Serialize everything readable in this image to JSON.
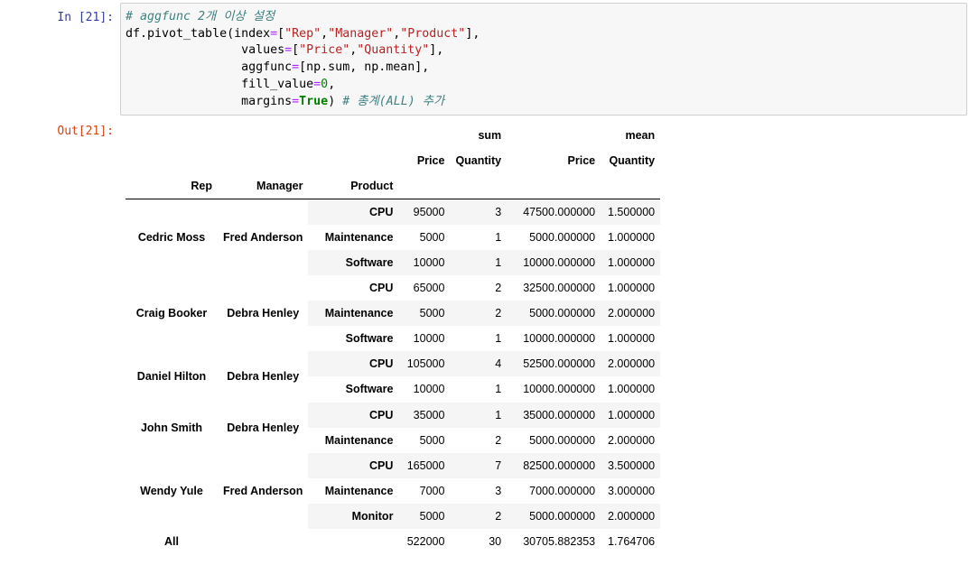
{
  "input_prompt": "In [21]:",
  "output_prompt": "Out[21]:",
  "code": {
    "comment1": "# aggfunc 2개 이상 설정",
    "l1_a": "df.pivot_table(index",
    "l1_b": "=",
    "l1_c": "[",
    "l1_s1": "\"Rep\"",
    "l1_s2": "\"Manager\"",
    "l1_s3": "\"Product\"",
    "l1_d": "],",
    "l2_a": "values",
    "l2_b": "=",
    "l2_c": "[",
    "l2_s1": "\"Price\"",
    "l2_s2": "\"Quantity\"",
    "l2_d": "],",
    "l3_a": "aggfunc",
    "l3_b": "=",
    "l3_c": "[np.sum, np.mean],",
    "l4_a": "fill_value",
    "l4_b": "=",
    "l4_n": "0",
    "l4_c": ",",
    "l5_a": "margins",
    "l5_b": "=",
    "l5_kw": "True",
    "l5_c": ") ",
    "comment2": "# 총계(ALL) 추가"
  },
  "table": {
    "agg_headers": [
      "sum",
      "mean"
    ],
    "value_headers": [
      "Price",
      "Quantity",
      "Price",
      "Quantity"
    ],
    "index_names": [
      "Rep",
      "Manager",
      "Product"
    ],
    "groups": [
      {
        "rep": "Cedric Moss",
        "manager": "Fred Anderson",
        "rows": [
          {
            "product": "CPU",
            "vals": [
              "95000",
              "3",
              "47500.000000",
              "1.500000"
            ]
          },
          {
            "product": "Maintenance",
            "vals": [
              "5000",
              "1",
              "5000.000000",
              "1.000000"
            ]
          },
          {
            "product": "Software",
            "vals": [
              "10000",
              "1",
              "10000.000000",
              "1.000000"
            ]
          }
        ]
      },
      {
        "rep": "Craig Booker",
        "manager": "Debra Henley",
        "rows": [
          {
            "product": "CPU",
            "vals": [
              "65000",
              "2",
              "32500.000000",
              "1.000000"
            ]
          },
          {
            "product": "Maintenance",
            "vals": [
              "5000",
              "2",
              "5000.000000",
              "2.000000"
            ]
          },
          {
            "product": "Software",
            "vals": [
              "10000",
              "1",
              "10000.000000",
              "1.000000"
            ]
          }
        ]
      },
      {
        "rep": "Daniel Hilton",
        "manager": "Debra Henley",
        "rows": [
          {
            "product": "CPU",
            "vals": [
              "105000",
              "4",
              "52500.000000",
              "2.000000"
            ]
          },
          {
            "product": "Software",
            "vals": [
              "10000",
              "1",
              "10000.000000",
              "1.000000"
            ]
          }
        ]
      },
      {
        "rep": "John Smith",
        "manager": "Debra Henley",
        "rows": [
          {
            "product": "CPU",
            "vals": [
              "35000",
              "1",
              "35000.000000",
              "1.000000"
            ]
          },
          {
            "product": "Maintenance",
            "vals": [
              "5000",
              "2",
              "5000.000000",
              "2.000000"
            ]
          }
        ]
      },
      {
        "rep": "Wendy Yule",
        "manager": "Fred Anderson",
        "rows": [
          {
            "product": "CPU",
            "vals": [
              "165000",
              "7",
              "82500.000000",
              "3.500000"
            ]
          },
          {
            "product": "Maintenance",
            "vals": [
              "7000",
              "3",
              "7000.000000",
              "3.000000"
            ]
          },
          {
            "product": "Monitor",
            "vals": [
              "5000",
              "2",
              "5000.000000",
              "2.000000"
            ]
          }
        ]
      }
    ],
    "total": {
      "label": "All",
      "vals": [
        "522000",
        "30",
        "30705.882353",
        "1.764706"
      ]
    }
  }
}
